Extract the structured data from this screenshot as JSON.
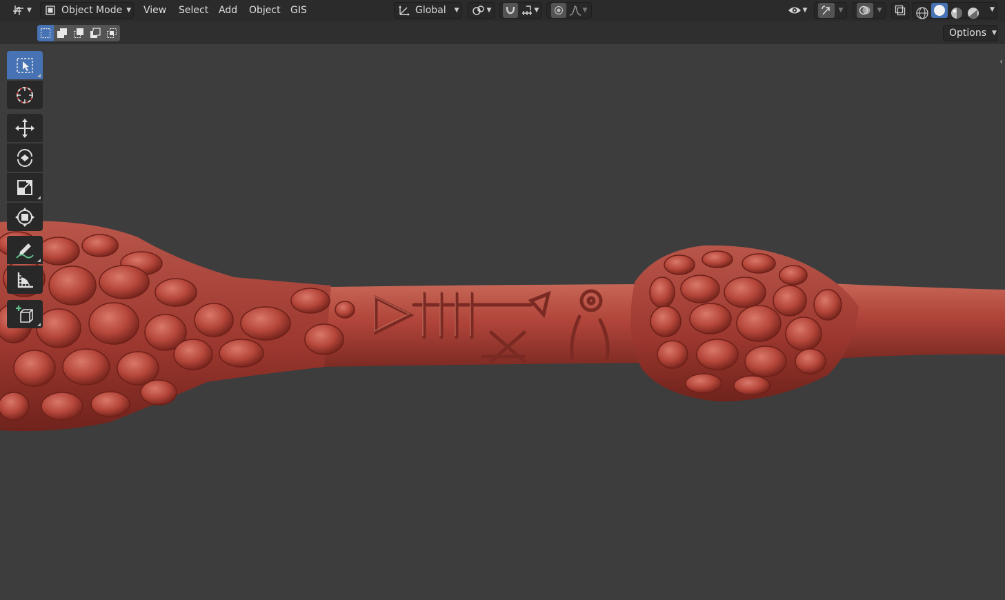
{
  "header": {
    "editor_type_icon": "axes-grid-icon",
    "mode": {
      "label": "Object Mode",
      "icon": "object-cube-icon"
    },
    "menus": [
      "View",
      "Select",
      "Add",
      "Object",
      "GIS"
    ],
    "transform_orientation": {
      "label": "Global",
      "icon": "orientation-axes-icon"
    },
    "pivot_icon": "pivot-link-icon",
    "snap_icon": "magnet-icon",
    "snap_target_icon": "snap-increment-icon",
    "proportional_icon": "proportional-dot-icon",
    "falloff_icon": "falloff-curve-icon",
    "visibility_icon": "eye-icon",
    "gizmo_icon": "gizmo-arrow-icon",
    "overlay_icon": "overlay-circles-icon",
    "xray_icon": "xray-square-icon",
    "shading_modes": [
      "wireframe",
      "solid",
      "material-preview",
      "rendered"
    ],
    "active_shading": "solid"
  },
  "subheader": {
    "selection_modes": [
      "set",
      "extend",
      "subtract",
      "invert",
      "intersect"
    ],
    "active_selection_mode": "set",
    "options_label": "Options"
  },
  "toolbar": {
    "tools": [
      {
        "name": "select-box",
        "active": true
      },
      {
        "name": "cursor",
        "active": false
      },
      {
        "name": "move",
        "active": false
      },
      {
        "name": "rotate",
        "active": false
      },
      {
        "name": "scale",
        "active": false
      },
      {
        "name": "transform",
        "active": false
      },
      {
        "name": "annotate",
        "active": false
      },
      {
        "name": "measure",
        "active": false
      },
      {
        "name": "add-cube",
        "active": false
      }
    ]
  },
  "colors": {
    "header_bg": "#2b2b2b",
    "viewport_bg": "#3d3d3d",
    "accent_blue": "#4772b3",
    "model_red": "#b5463a"
  }
}
